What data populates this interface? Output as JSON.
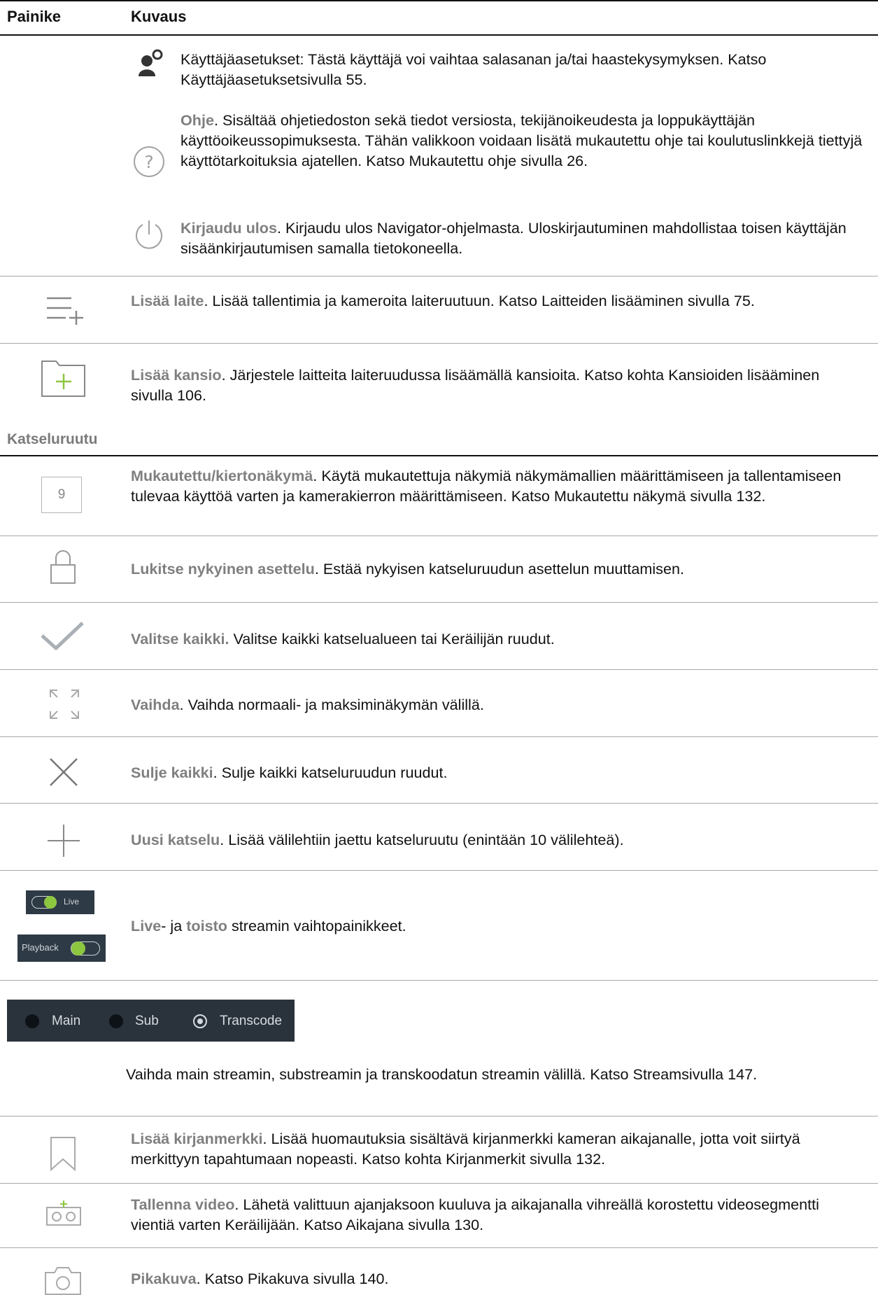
{
  "header": {
    "col1": "Painike",
    "col2": "Kuvaus"
  },
  "rows": {
    "user_settings": {
      "text": "Käyttäjäasetukset: Tästä käyttäjä voi vaihtaa salasanan ja/tai haastekysymyksen. Katso Käyttäjäasetuksetsivulla 55."
    },
    "help": {
      "term": "Ohje",
      "text": ". Sisältää ohjetiedoston sekä tiedot versiosta, tekijänoikeudesta ja loppukäyttäjän käyttöoikeussopimuksesta. Tähän valikkoon voidaan lisätä mukautettu ohje tai koulutuslinkkejä tiettyjä käyttötarkoituksia ajatellen. Katso Mukautettu ohje sivulla 26."
    },
    "logout": {
      "term": "Kirjaudu ulos",
      "text": ". Kirjaudu ulos Navigator-ohjelmasta. Uloskirjautuminen mahdollistaa toisen käyttäjän sisäänkirjautumisen samalla tietokoneella."
    },
    "add_device": {
      "term": "Lisää laite",
      "text": ". Lisää tallentimia ja kameroita laiteruutuun. Katso Laitteiden lisääminen sivulla 75."
    },
    "add_folder": {
      "term": "Lisää kansio",
      "text": ". Järjestele laitteita laiteruudussa lisäämällä kansioita. Katso kohta Kansioiden lisääminen sivulla 106."
    },
    "section": "Katseluruutu",
    "custom_view": {
      "icon_number": "9",
      "term": "Mukautettu/kiertonäkymä",
      "text": ". Käytä mukautettuja näkymiä näkymämallien määrittämiseen ja tallentamiseen tulevaa käyttöä varten ja kamerakierron määrittämiseen. Katso Mukautettu näkymä sivulla 132."
    },
    "lock": {
      "term": "Lukitse nykyinen asettelu",
      "text": ". Estää nykyisen katseluruudun asettelun muuttamisen."
    },
    "select_all": {
      "term": "Valitse kaikki.",
      "text": " Valitse kaikki katselualueen tai Keräilijän ruudut."
    },
    "toggle_view": {
      "term": "Vaihda",
      "text": ". Vaihda normaali- ja maksiminäkymän välillä."
    },
    "close_all": {
      "term": "Sulje kaikki",
      "text": ". Sulje kaikki katseluruudun ruudut."
    },
    "new_view": {
      "term": "Uusi katselu",
      "text": ". Lisää välilehtiin jaettu katseluruutu (enintään 10 välilehteä)."
    },
    "live_playback": {
      "live_label": "Live",
      "playback_label": "Playback",
      "term1": "Live",
      "mid": "- ja ",
      "term2": "toisto",
      "text": " streamin vaihtopainikkeet."
    },
    "streams": {
      "main": "Main",
      "sub": "Sub",
      "transcode": "Transcode",
      "text": "Vaihda main streamin, substreamin ja transkoodatun streamin välillä. Katso Streamsivulla 147."
    },
    "bookmark": {
      "term": "Lisää kirjanmerkki",
      "text": ". Lisää huomautuksia sisältävä kirjanmerkki kameran aikajanalle, jotta voit siirtyä merkittyyn tapahtumaan nopeasti. Katso kohta Kirjanmerkit sivulla 132."
    },
    "save_video": {
      "term": "Tallenna video",
      "text": ". Lähetä valittuun ajanjaksoon kuuluva ja aikajanalla vihreällä korostettu videosegmentti vientiä varten Keräilijään. Katso Aikajana sivulla 130."
    },
    "snapshot": {
      "term": "Pikakuva",
      "text": ". Katso Pikakuva sivulla 140."
    }
  },
  "colors": {
    "term": "#7f7f7f",
    "accent_green": "#8dc63f",
    "dark_panel": "#2a333c"
  }
}
